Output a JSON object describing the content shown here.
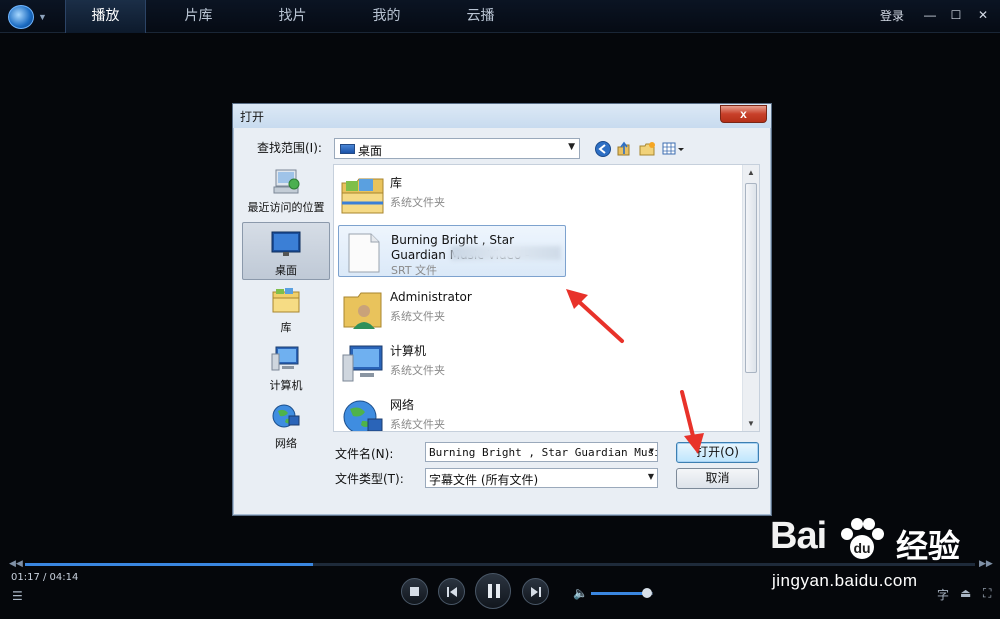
{
  "topbar": {
    "tabs": [
      {
        "label": "播放",
        "active": true
      },
      {
        "label": "片库"
      },
      {
        "label": "找片"
      },
      {
        "label": "我的"
      },
      {
        "label": "云播"
      }
    ],
    "login": "登录",
    "icons": [
      "minimize-icon",
      "maximize-icon",
      "close-icon"
    ]
  },
  "dialog": {
    "title": "打开",
    "close_glyph": "x",
    "lookin_label": "查找范围(I):",
    "lookin_value": "桌面",
    "places": [
      {
        "label": "最近访问的位置",
        "icon": "recent-places-icon"
      },
      {
        "label": "桌面",
        "icon": "desktop-icon",
        "selected": true
      },
      {
        "label": "库",
        "icon": "library-icon"
      },
      {
        "label": "计算机",
        "icon": "computer-icon"
      },
      {
        "label": "网络",
        "icon": "network-icon"
      }
    ],
    "files": [
      {
        "name": "库",
        "type": "系统文件夹",
        "icon": "library-folder-icon"
      },
      {
        "name": "Burning Bright , Star Guardian Music Video -",
        "type": "SRT 文件",
        "icon": "file-icon",
        "selected": true
      },
      {
        "name": "Administrator",
        "type": "系统文件夹",
        "icon": "user-folder-icon"
      },
      {
        "name": "计算机",
        "type": "系统文件夹",
        "icon": "computer-icon"
      },
      {
        "name": "网络",
        "type": "系统文件夹",
        "icon": "network-icon"
      }
    ],
    "filename_label": "文件名(N):",
    "filename_value": "Burning Bright , Star Guardian Music",
    "filetype_label": "文件类型(T):",
    "filetype_value": "字幕文件 (所有文件)",
    "open_button": "打开(O)",
    "cancel_button": "取消"
  },
  "player": {
    "time": "01:17 / 04:14",
    "progress_fraction": 0.303,
    "volume_fraction": 0.91,
    "subtitle_glyph": "字"
  },
  "watermark": {
    "brand_left": "Bai",
    "brand_right": "经验",
    "url": "jingyan.baidu.com"
  },
  "colors": {
    "accent": "#3a86e0",
    "arrow_red": "#e8322a",
    "background": "#05070b"
  }
}
